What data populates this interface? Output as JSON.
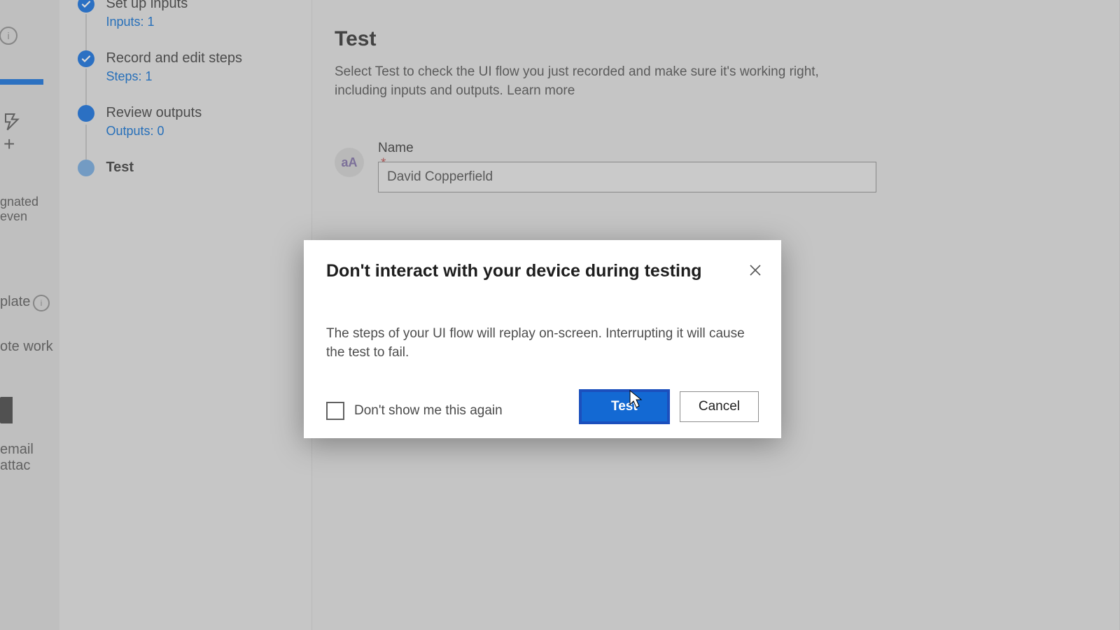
{
  "rail": {
    "text_events": "gnated even",
    "text_tpl": "plate",
    "text_work": "ote work",
    "text_attach": "email attac"
  },
  "stepper": {
    "items": [
      {
        "main": "Set up inputs",
        "sub": "Inputs: 1"
      },
      {
        "main": "Record and edit steps",
        "sub": "Steps: 1"
      },
      {
        "main": "Review outputs",
        "sub": "Outputs: 0"
      },
      {
        "main": "Test",
        "sub": ""
      }
    ]
  },
  "main": {
    "title": "Test",
    "desc": "Select Test to check the UI flow you just recorded and make sure it's working right, including inputs and outputs. Learn more",
    "field_badge": "aA",
    "field_label": "Name",
    "field_required": "*",
    "field_value": "David Copperfield"
  },
  "modal": {
    "title": "Don't interact with your device during testing",
    "body": "The steps of your UI flow will replay on-screen. Interrupting it will cause the test to fail.",
    "checkbox_label": "Don't show me this again",
    "primary": "Test",
    "secondary": "Cancel"
  }
}
